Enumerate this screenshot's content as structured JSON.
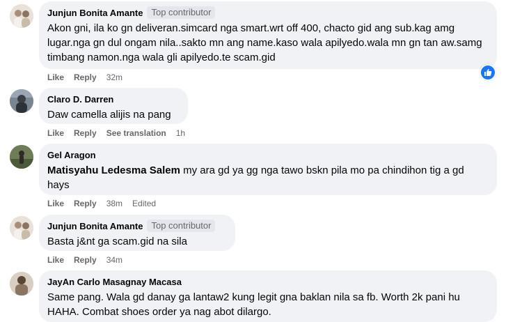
{
  "comments": [
    {
      "name": "Junjun Bonita Amante",
      "badge": "Top contributor",
      "text": "Akon gni, ila ko gn deliveran.simcard nga smart.wrt off 400, chacto gid ang sub.kag amg lugar.nga gn dul ongam nila..sakto mn ang name.kaso wala apilyedo.wala mn gn tan aw.samg timbang namon.nga wala gli apilyedo.te scam.gid",
      "like": "Like",
      "reply": "Reply",
      "time": "32m",
      "reaction": "like-icon"
    },
    {
      "name": "Claro D. Darren",
      "text": "Daw camella alijis na pang",
      "like": "Like",
      "reply": "Reply",
      "translate": "See translation",
      "time": "1h"
    },
    {
      "name": "Gel Aragon",
      "mention": "Matisyahu Ledesma Salem",
      "text": " my ara gd ya gg nga tawo bskn pila mo pa chindihon tig a gd hays",
      "like": "Like",
      "reply": "Reply",
      "time": "38m",
      "edited": "Edited"
    },
    {
      "name": "Junjun Bonita Amante",
      "badge": "Top contributor",
      "text": "Basta j&nt ga scam.gid na sila",
      "like": "Like",
      "reply": "Reply",
      "time": "34m"
    },
    {
      "name": "JayAn Carlo Masagnay Macasa",
      "text": "Same pang. Wala gd danay ga lantaw2 kung legit gna baklan nila sa fb. Worth 2k pani hu HAHA. Combat shoes order ya nag abot dilargo."
    }
  ],
  "colors": {
    "bubble": "#f0f2f5",
    "meta": "#65676b",
    "like_blue": "#1877f2"
  }
}
